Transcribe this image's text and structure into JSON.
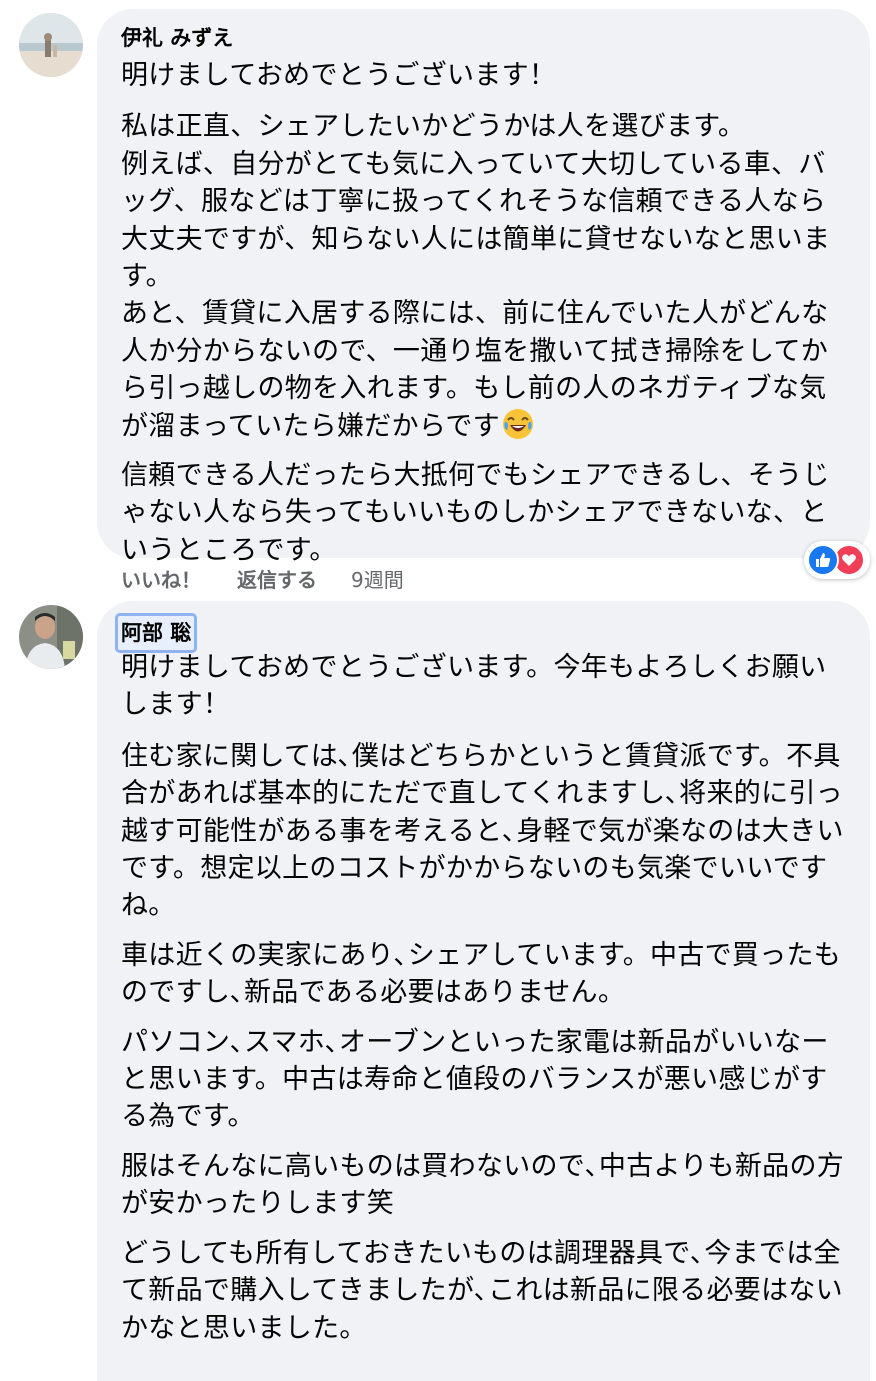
{
  "comments": [
    {
      "author": "伊礼 みずえ",
      "paragraphs": [
        "明けましておめでとうございます！",
        "私は正直、シェアしたいかどうかは人を選びます。\n例えば、自分がとても気に入っていて大切している車、バッグ、服などは丁寧に扱ってくれそうな信頼できる人なら大丈夫ですが、知らない人には簡単に貸せないなと思います。\nあと、賃貸に入居する際には、前に住んでいた人がどんな人か分からないので、一通り塩を撒いて拭き掃除をしてから引っ越しの物を入れます。もし前の人のネガティブな気が溜まっていたら嫌だからです",
        "信頼できる人だったら大抵何でもシェアできるし、そうじゃない人なら失ってもいいものしかシェアできないな、というところです。"
      ],
      "emoji": "laughing-tears-emoji",
      "actions": {
        "like_label": "いいね！",
        "reply_label": "返信する",
        "time": "9週間"
      },
      "reactions": [
        "like-icon",
        "love-icon"
      ]
    },
    {
      "author": "阿部 聡",
      "paragraphs": [
        "明けましておめでとうございます。今年もよろしくお願いします！",
        "住む家に関しては､僕はどちらかというと賃貸派です。不具合があれば基本的にただで直してくれますし､将来的に引っ越す可能性がある事を考えると､身軽で気が楽なのは大きいです。想定以上のコストがかからないのも気楽でいいですね。",
        "車は近くの実家にあり､シェアしています。中古で買ったものですし､新品である必要はありません。",
        "パソコン､スマホ､オーブンといった家電は新品がいいなーと思います。中古は寿命と値段のバランスが悪い感じがする為です。",
        "服はそんなに高いものは買わないので､中古よりも新品の方が安かったりします笑",
        "どうしても所有しておきたいものは調理器具で､今までは全て新品で購入してきましたが､これは新品に限る必要はないかなと思いました。"
      ]
    }
  ],
  "colors": {
    "bubble": "#f0f2f5",
    "text": "#050505",
    "meta": "#65676b",
    "like": "#1877f2",
    "love": "#f33e58",
    "highlight": "#8fb2f0"
  }
}
